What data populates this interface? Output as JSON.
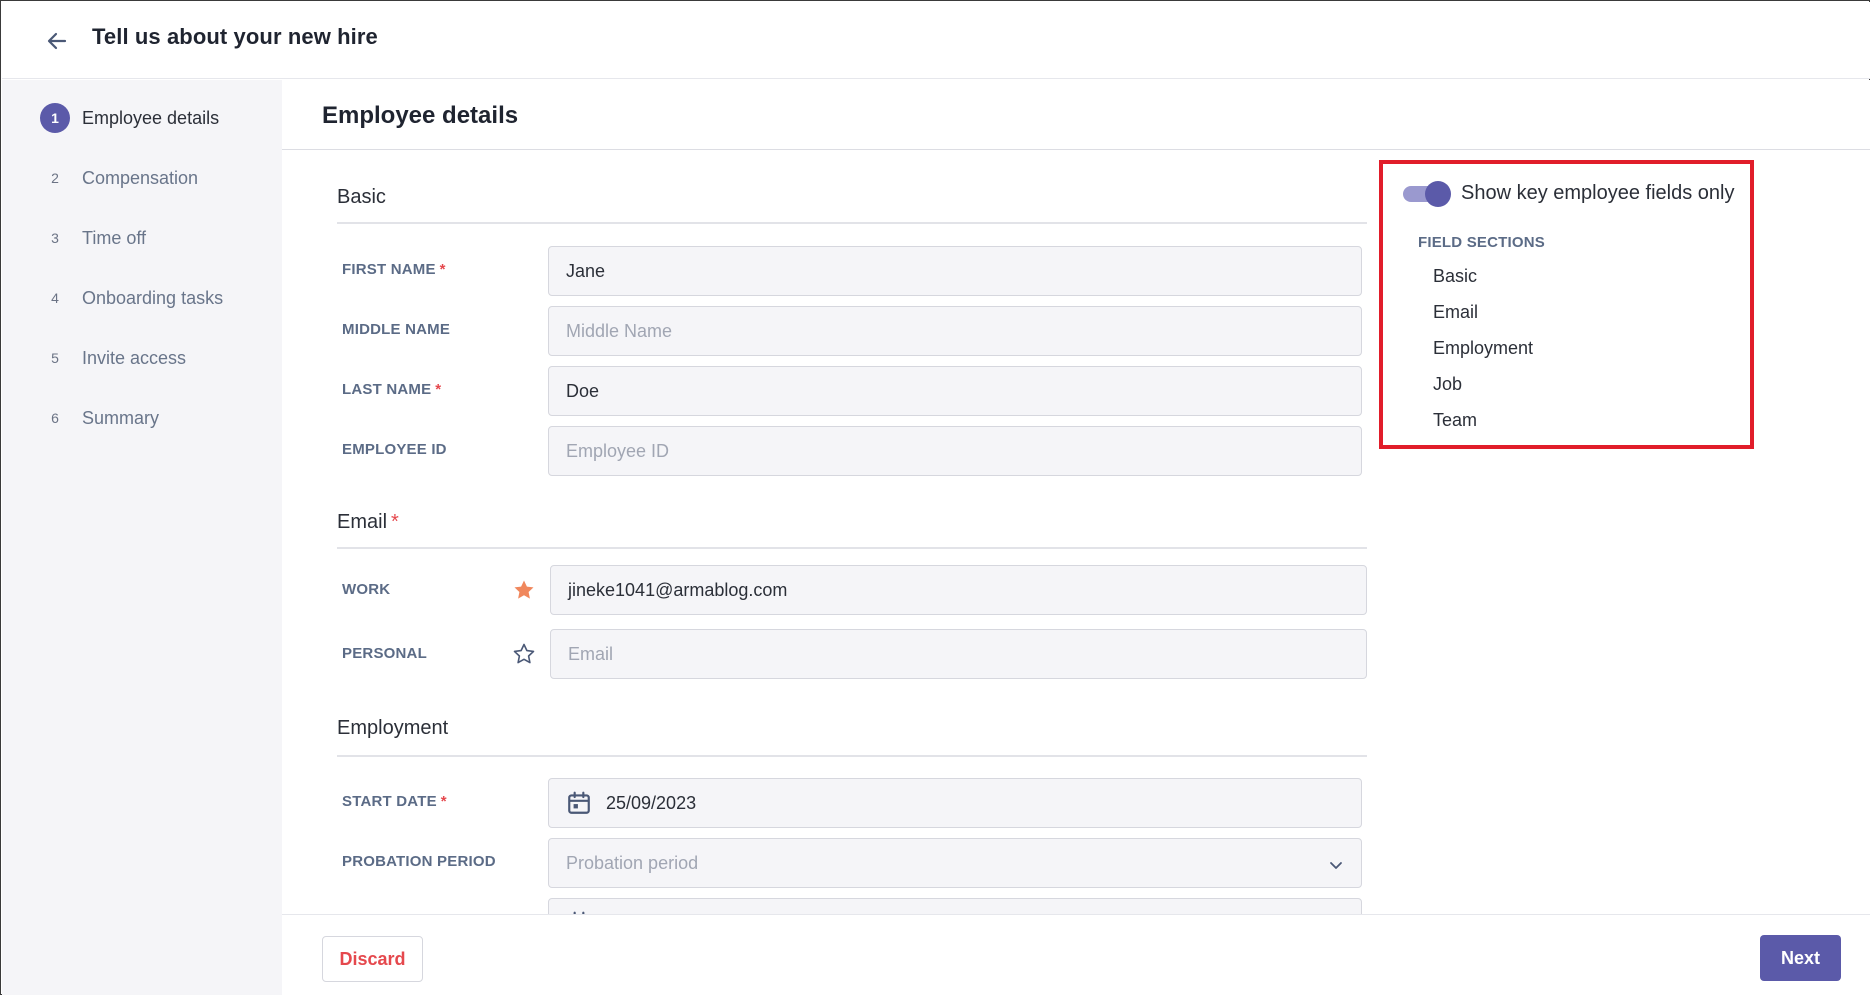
{
  "header": {
    "title": "Tell us about your new hire"
  },
  "sidebar": {
    "steps": [
      {
        "num": "1",
        "label": "Employee details"
      },
      {
        "num": "2",
        "label": "Compensation"
      },
      {
        "num": "3",
        "label": "Time off"
      },
      {
        "num": "4",
        "label": "Onboarding tasks"
      },
      {
        "num": "5",
        "label": "Invite access"
      },
      {
        "num": "6",
        "label": "Summary"
      }
    ],
    "active_step": "1"
  },
  "main": {
    "heading": "Employee details",
    "basic": {
      "title": "Basic",
      "first_name": {
        "label": "FIRST NAME",
        "value": "Jane"
      },
      "middle_name": {
        "label": "MIDDLE NAME",
        "placeholder": "Middle Name"
      },
      "last_name": {
        "label": "LAST NAME",
        "value": "Doe"
      },
      "employee_id": {
        "label": "EMPLOYEE ID",
        "placeholder": "Employee ID"
      }
    },
    "email": {
      "title": "Email",
      "work": {
        "label": "WORK",
        "value": "jineke1041@armablog.com"
      },
      "personal": {
        "label": "PERSONAL",
        "placeholder": "Email"
      }
    },
    "employment": {
      "title": "Employment",
      "start_date": {
        "label": "START DATE",
        "value": "25/09/2023"
      },
      "probation_period": {
        "label": "PROBATION PERIOD",
        "placeholder": "Probation period"
      }
    },
    "required_mark": "*"
  },
  "panel": {
    "toggle_label": "Show key employee fields only",
    "toggle_on": true,
    "field_sections_heading": "FIELD SECTIONS",
    "field_sections": [
      "Basic",
      "Email",
      "Employment",
      "Job",
      "Team"
    ]
  },
  "footer": {
    "discard_label": "Discard",
    "next_label": "Next"
  },
  "colors": {
    "accent": "#5b5aa9",
    "danger": "#e5484d",
    "star_filled": "#f0875c",
    "highlight": "#e11d2a"
  }
}
